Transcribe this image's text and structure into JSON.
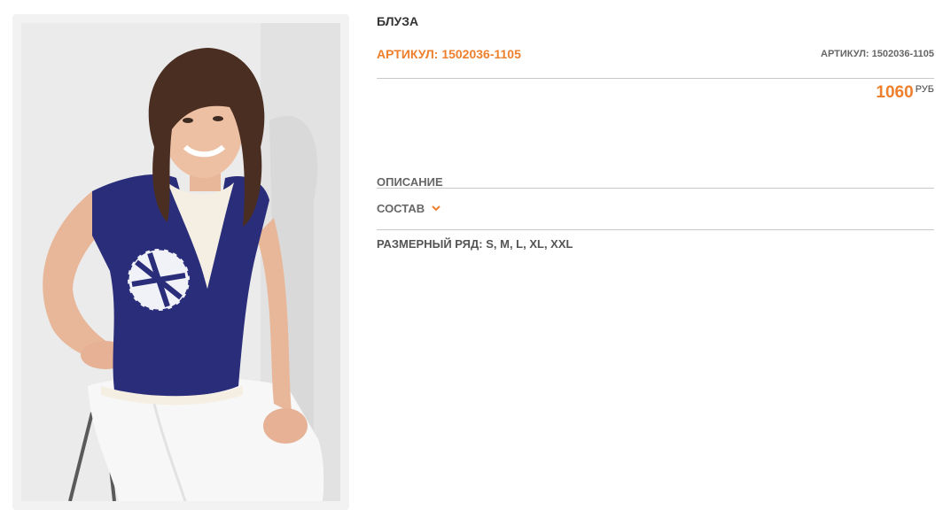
{
  "product": {
    "title": "БЛУЗА",
    "article_main": "АРТИКУЛ: 1502036-1105",
    "article_side": "АРТИКУЛ: 1502036-1105",
    "price": "1060",
    "currency": "РУБ",
    "image_alt": "model-photo"
  },
  "sections": {
    "description_label": "ОПИСАНИЕ",
    "composition_label": "СОСТАВ",
    "sizes_label": "РАЗМЕРНЫЙ РЯД:",
    "sizes_value": "S, M, L, XL, XXL"
  },
  "colors": {
    "accent": "#ee7f2d",
    "text": "#333333",
    "muted": "#666666",
    "divider": "#c8c8c8",
    "blouse_navy": "#2a2d7a"
  }
}
